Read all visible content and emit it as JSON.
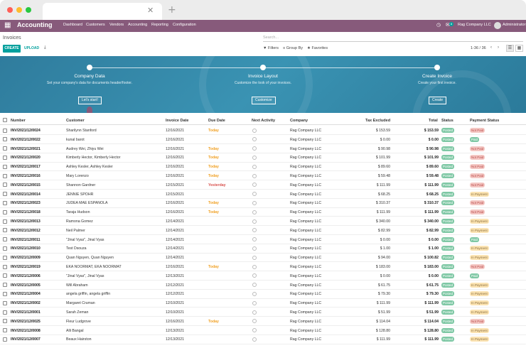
{
  "browser": {
    "tab_close": "✕",
    "tab_new": "+"
  },
  "nav": {
    "app_title": "Accounting",
    "menu": [
      "Dashboard",
      "Customers",
      "Vendors",
      "Accounting",
      "Reporting",
      "Configuration"
    ],
    "notification_count": "8",
    "company": "Rag Company LLC",
    "user": "Administrator"
  },
  "control": {
    "breadcrumb": "Invoices",
    "search_placeholder": "Search...",
    "create_label": "CREATE",
    "upload_label": "UPLOAD",
    "filters_label": "Filters",
    "groupby_label": "Group By",
    "favorites_label": "Favorites",
    "pager": "1-36 / 36"
  },
  "banner": {
    "steps": [
      {
        "title": "Company Data",
        "desc": "Set your company's data for documents header/footer.",
        "button": "Let's start!"
      },
      {
        "title": "Invoice Layout",
        "desc": "Customize the look of your invoices.",
        "button": "Customize"
      },
      {
        "title": "Create Invoice",
        "desc": "Create your first invoice.",
        "button": "Create"
      }
    ]
  },
  "table": {
    "headers": [
      "Number",
      "Customer",
      "Invoice Date",
      "Due Date",
      "Next Activity",
      "Company",
      "Tax Excluded",
      "Total",
      "Status",
      "Payment Status"
    ],
    "rows": [
      {
        "number": "INV/2021/12/0024",
        "customer": "Sharilynn Stanford",
        "invoice_date": "12/16/2021",
        "due": "Today",
        "company": "Rag Company LLC",
        "tax_excl": "$ 153.59",
        "total": "$ 153.59",
        "status": "Posted",
        "payment": "Not Paid"
      },
      {
        "number": "INV/2021/12/0022",
        "customer": "kunal barot",
        "invoice_date": "12/16/2021",
        "due": "",
        "company": "Rag Company LLC",
        "tax_excl": "$ 0.00",
        "total": "$ 0.00",
        "status": "Posted",
        "payment": "Paid"
      },
      {
        "number": "INV/2021/12/0021",
        "customer": "Audrey Wei, Zhiyu Wei",
        "invoice_date": "12/16/2021",
        "due": "Today",
        "company": "Rag Company LLC",
        "tax_excl": "$ 90.98",
        "total": "$ 90.98",
        "status": "Posted",
        "payment": "Not Paid"
      },
      {
        "number": "INV/2021/12/0020",
        "customer": "Kimberly Hector, Kimberly Hector",
        "invoice_date": "12/16/2021",
        "due": "Today",
        "company": "Rag Company LLC",
        "tax_excl": "$ 101.99",
        "total": "$ 101.99",
        "status": "Posted",
        "payment": "Not Paid"
      },
      {
        "number": "INV/2021/12/0017",
        "customer": "Ashley Kesler, Ashley Kesler",
        "invoice_date": "12/16/2021",
        "due": "Today",
        "company": "Rag Company LLC",
        "tax_excl": "$ 89.60",
        "total": "$ 89.60",
        "status": "Posted",
        "payment": "Not Paid"
      },
      {
        "number": "INV/2021/12/0016",
        "customer": "Mary Lorenzo",
        "invoice_date": "12/16/2021",
        "due": "Today",
        "company": "Rag Company LLC",
        "tax_excl": "$ 59.48",
        "total": "$ 59.48",
        "status": "Posted",
        "payment": "Not Paid"
      },
      {
        "number": "INV/2021/12/0015",
        "customer": "Shannon Gardner",
        "invoice_date": "12/15/2021",
        "due": "Yesterday",
        "company": "Rag Company LLC",
        "tax_excl": "$ 111.99",
        "total": "$ 111.99",
        "status": "Posted",
        "payment": "Not Paid"
      },
      {
        "number": "INV/2021/12/0014",
        "customer": "JENNIE SPOHR",
        "invoice_date": "12/15/2021",
        "due": "",
        "company": "Rag Company LLC",
        "tax_excl": "$ 68.25",
        "total": "$ 68.25",
        "status": "Posted",
        "payment": "In Payment"
      },
      {
        "number": "INV/2021/12/0023",
        "customer": "JUDEA MAE ESPAÑOLA",
        "invoice_date": "12/16/2021",
        "due": "Today",
        "company": "Rag Company LLC",
        "tax_excl": "$ 310.37",
        "total": "$ 310.37",
        "status": "Posted",
        "payment": "Not Paid"
      },
      {
        "number": "INV/2021/12/0018",
        "customer": "Taraja Hudson",
        "invoice_date": "12/16/2021",
        "due": "Today",
        "company": "Rag Company LLC",
        "tax_excl": "$ 111.99",
        "total": "$ 111.99",
        "status": "Posted",
        "payment": "Not Paid"
      },
      {
        "number": "INV/2021/12/0013",
        "customer": "Ramona Gomez",
        "invoice_date": "12/14/2021",
        "due": "",
        "company": "Rag Company LLC",
        "tax_excl": "$ 340.00",
        "total": "$ 340.00",
        "status": "Posted",
        "payment": "In Payment"
      },
      {
        "number": "INV/2021/12/0012",
        "customer": "Neil Palmer",
        "invoice_date": "12/14/2021",
        "due": "",
        "company": "Rag Company LLC",
        "tax_excl": "$ 82.99",
        "total": "$ 82.99",
        "status": "Posted",
        "payment": "In Payment"
      },
      {
        "number": "INV/2021/12/0011",
        "customer": "\"Jinal Vyas\", Jinal Vyas",
        "invoice_date": "12/14/2021",
        "due": "",
        "company": "Rag Company LLC",
        "tax_excl": "$ 0.00",
        "total": "$ 0.00",
        "status": "Posted",
        "payment": "Paid"
      },
      {
        "number": "INV/2021/12/0010",
        "customer": "Test Dsouza",
        "invoice_date": "12/14/2021",
        "due": "",
        "company": "Rag Company LLC",
        "tax_excl": "$ 1.00",
        "total": "$ 1.00",
        "status": "Posted",
        "payment": "In Payment"
      },
      {
        "number": "INV/2021/12/0009",
        "customer": "Quan Nguyen, Quan Nguyen",
        "invoice_date": "12/14/2021",
        "due": "",
        "company": "Rag Company LLC",
        "tax_excl": "$ 94.00",
        "total": "$ 100.82",
        "status": "Posted",
        "payment": "In Payment"
      },
      {
        "number": "INV/2021/12/0019",
        "customer": "EKA NOORMAT, EKA NOORMAT",
        "invoice_date": "12/16/2021",
        "due": "Today",
        "company": "Rag Company LLC",
        "tax_excl": "$ 183.00",
        "total": "$ 183.00",
        "status": "Posted",
        "payment": "Not Paid"
      },
      {
        "number": "INV/2021/12/0006",
        "customer": "\"Jinal Vyas\", Jinal Vyas",
        "invoice_date": "12/13/2021",
        "due": "",
        "company": "Rag Company LLC",
        "tax_excl": "$ 0.00",
        "total": "$ 0.00",
        "status": "Posted",
        "payment": "Paid"
      },
      {
        "number": "INV/2021/12/0005",
        "customer": "Will Abraham",
        "invoice_date": "12/12/2021",
        "due": "",
        "company": "Rag Company LLC",
        "tax_excl": "$ 61.75",
        "total": "$ 61.75",
        "status": "Posted",
        "payment": "In Payment"
      },
      {
        "number": "INV/2021/12/0004",
        "customer": "angela griffin, angela griffin",
        "invoice_date": "12/12/2021",
        "due": "",
        "company": "Rag Company LLC",
        "tax_excl": "$ 79.30",
        "total": "$ 79.30",
        "status": "Posted",
        "payment": "In Payment"
      },
      {
        "number": "INV/2021/12/0002",
        "customer": "Margaret Cruman",
        "invoice_date": "12/10/2021",
        "due": "",
        "company": "Rag Company LLC",
        "tax_excl": "$ 111.99",
        "total": "$ 111.99",
        "status": "Posted",
        "payment": "In Payment"
      },
      {
        "number": "INV/2021/12/0001",
        "customer": "Sarah Zeman",
        "invoice_date": "12/10/2021",
        "due": "",
        "company": "Rag Company LLC",
        "tax_excl": "$ 51.99",
        "total": "$ 51.99",
        "status": "Posted",
        "payment": "In Payment"
      },
      {
        "number": "INV/2021/12/0025",
        "customer": "Fleur Ludgrove",
        "invoice_date": "12/16/2021",
        "due": "Today",
        "company": "Rag Company LLC",
        "tax_excl": "$ 114.04",
        "total": "$ 114.04",
        "status": "Posted",
        "payment": "Not Paid"
      },
      {
        "number": "INV/2021/12/0008",
        "customer": "Alli Bangal",
        "invoice_date": "12/13/2021",
        "due": "",
        "company": "Rag Company LLC",
        "tax_excl": "$ 128.80",
        "total": "$ 128.80",
        "status": "Posted",
        "payment": "In Payment"
      },
      {
        "number": "INV/2021/12/0007",
        "customer": "Beaux Hairston",
        "invoice_date": "12/13/2021",
        "due": "",
        "company": "Rag Company LLC",
        "tax_excl": "$ 111.99",
        "total": "$ 111.99",
        "status": "Posted",
        "payment": "In Payment"
      }
    ]
  },
  "colors": {
    "brand": "#875a7b",
    "accent": "#00a09d",
    "today": "#f0a023",
    "yesterday": "#d9534f",
    "posted": "#7fc8a5",
    "not_paid_bg": "#f4c7c3",
    "not_paid_fg": "#b94a48",
    "paid_bg": "#7fc8a5",
    "in_payment_bg": "#fbe3b2",
    "in_payment_fg": "#8a6d3b"
  },
  "icons": {
    "apps": "apps-grid-icon",
    "clock": "clock-icon",
    "chat": "chat-icon",
    "filter": "filter-icon",
    "groupby": "layers-icon",
    "favorites": "star-icon",
    "download": "download-icon",
    "list_view": "list-view-icon",
    "kanban_view": "kanban-view-icon"
  }
}
